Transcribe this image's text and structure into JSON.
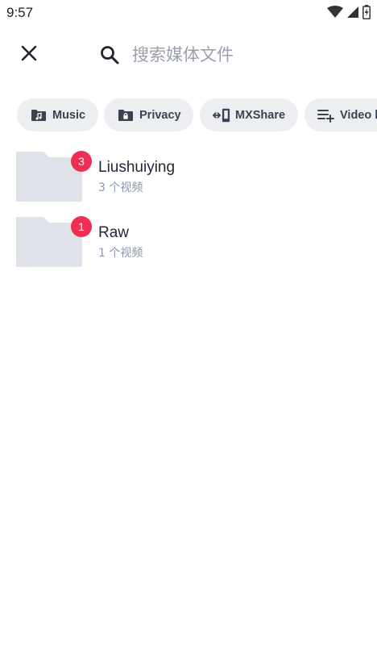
{
  "status_bar": {
    "time": "9:57",
    "icons": [
      "wifi-icon",
      "cell-signal-icon",
      "battery-icon"
    ]
  },
  "search": {
    "close_icon": "close-icon",
    "search_icon": "search-icon",
    "placeholder": "搜索媒体文件",
    "value": ""
  },
  "chips": [
    {
      "label": "Music",
      "icon": "music-folder-icon"
    },
    {
      "label": "Privacy",
      "icon": "lock-folder-icon"
    },
    {
      "label": "MXShare",
      "icon": "share-transfer-icon"
    },
    {
      "label": "Video l",
      "icon": "playlist-add-icon"
    }
  ],
  "folders": [
    {
      "name": "Liushuiying",
      "count_text": "3 个视频",
      "badge": "3"
    },
    {
      "name": "Raw",
      "count_text": "1 个视频",
      "badge": "1"
    }
  ],
  "colors": {
    "badge": "#ee2e52",
    "chip_bg": "#eceef2",
    "folder_fill": "#dfe2e8",
    "subtext": "#8b95ad"
  }
}
